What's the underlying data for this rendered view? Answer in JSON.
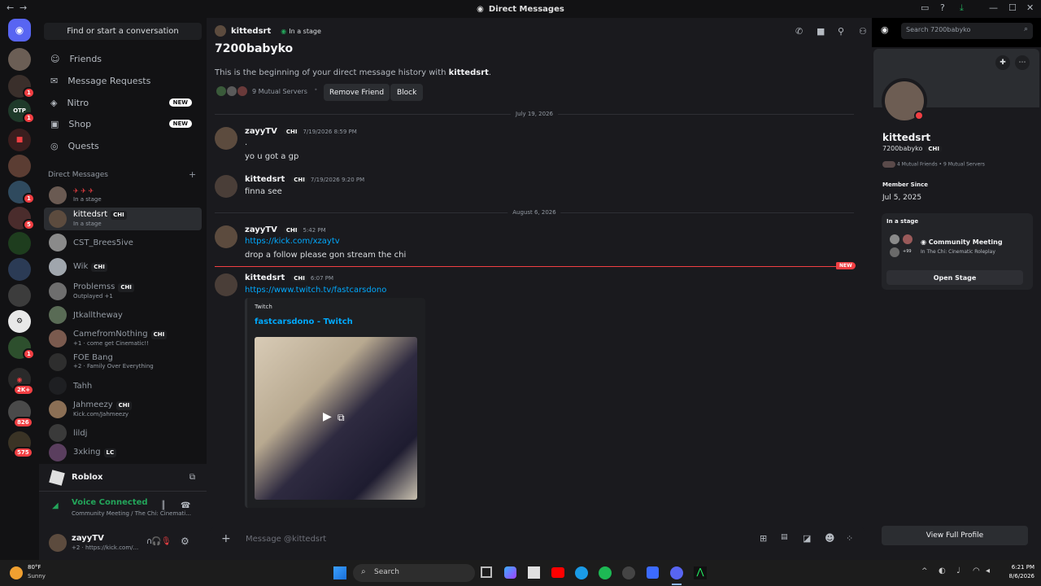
{
  "window": {
    "title": "Direct Messages"
  },
  "search": {
    "find_label": "Find or start a conversation",
    "header_placeholder": "Search 7200babyko"
  },
  "nav": [
    {
      "label": "Friends",
      "icon": "friends-icon"
    },
    {
      "label": "Message Requests",
      "icon": "mail-icon"
    },
    {
      "label": "Nitro",
      "icon": "nitro-icon",
      "tag": "NEW"
    },
    {
      "label": "Shop",
      "icon": "shop-icon",
      "tag": "NEW"
    },
    {
      "label": "Quests",
      "icon": "quests-icon"
    }
  ],
  "dm_header": "Direct Messages",
  "dms": [
    {
      "name": "",
      "sub": "In a stage"
    },
    {
      "name": "kittedsrt",
      "tag": "CHI",
      "sub": "In a stage"
    },
    {
      "name": "CST_Brees5ive",
      "sub": ""
    },
    {
      "name": "Wik",
      "tag": "CHI",
      "sub": ""
    },
    {
      "name": "Problemss",
      "tag": "CHI",
      "sub": "Outplayed +1"
    },
    {
      "name": "Jtkalltheway",
      "sub": ""
    },
    {
      "name": "CamefromNothing",
      "tag": "CHI",
      "sub": "+1 · come get Cinematic!!"
    },
    {
      "name": "FOE Bang",
      "sub": "+2 · Family Over Everything"
    },
    {
      "name": "Tahh",
      "sub": ""
    },
    {
      "name": "Jahmeezy",
      "tag": "CHI",
      "sub": "Kick.com/Jahmeezy"
    },
    {
      "name": "lildj",
      "sub": ""
    },
    {
      "name": "3xking",
      "tag": "LC",
      "sub": ""
    }
  ],
  "activity": {
    "game": "Roblox"
  },
  "voice": {
    "status": "Voice Connected",
    "channel": "Community Meeting / The Chi: Cinemati..."
  },
  "user": {
    "name": "zayyTV",
    "status": "+2 · https://kick.com/..."
  },
  "header": {
    "name": "kittedsrt",
    "status": "In a stage"
  },
  "intro": {
    "username": "7200babyko",
    "text_prefix": "This is the beginning of your direct message history with ",
    "text_name": "kittedsrt",
    "text_suffix": ".",
    "mutual": "9 Mutual Servers",
    "remove_label": "Remove Friend",
    "block_label": "Block"
  },
  "dates": [
    "July 19, 2026",
    "August 6, 2026"
  ],
  "messages": [
    {
      "author": "zayyTV",
      "tag": "CHI",
      "time": "7/19/2026 8:59 PM",
      "lines": [
        ".",
        "yo u got a gp"
      ]
    },
    {
      "author": "kittedsrt",
      "tag": "CHI",
      "time": "7/19/2026 9:20 PM",
      "lines": [
        "finna see"
      ]
    },
    {
      "author": "zayyTV",
      "tag": "CHI",
      "time": "5:42 PM",
      "link": "https://kick.com/xzaytv",
      "lines": [
        "drop a follow please gon stream the chi"
      ]
    },
    {
      "author": "kittedsrt",
      "tag": "CHI",
      "time": "6:07 PM",
      "link": "https://www.twitch.tv/fastcarsdono"
    }
  ],
  "new_label": "NEW",
  "embed": {
    "provider": "Twitch",
    "title": "fastcarsdono - Twitch"
  },
  "composer": {
    "placeholder": "Message @kittedsrt"
  },
  "profile": {
    "display_name": "kittedsrt",
    "username": "7200babyko",
    "tag": "CHI",
    "mutual_friends": "4 Mutual Friends",
    "mutual_servers": "9 Mutual Servers",
    "member_since_label": "Member Since",
    "member_since": "Jul 5, 2025",
    "in_stage_label": "In a stage",
    "stage_name": "Community Meeting",
    "stage_sub": "In The Chi: Cinematic Roleplay",
    "stage_count": "+99",
    "open_stage": "Open Stage",
    "view_full": "View Full Profile"
  },
  "badges": [
    "1",
    "1",
    "1",
    "5",
    "1",
    "2K+",
    "826",
    "575"
  ],
  "taskbar": {
    "weather_temp": "80°F",
    "weather_desc": "Sunny",
    "search": "Search",
    "time": "6:21 PM",
    "date": "8/6/2026"
  },
  "colors": {
    "accent": "#5865f2",
    "link": "#00a8fc",
    "new": "#f23f43",
    "online": "#23a55a"
  }
}
